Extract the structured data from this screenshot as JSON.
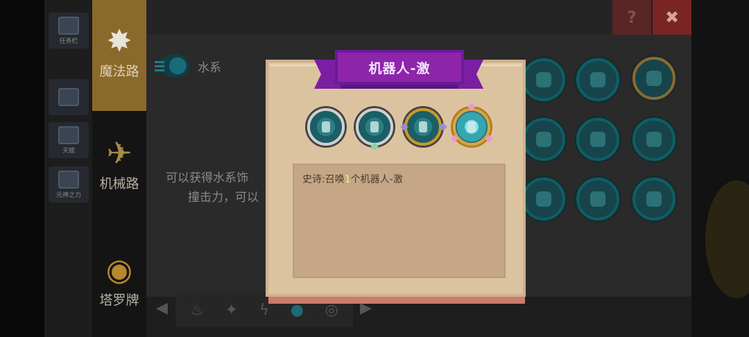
{
  "app": {
    "categories": [
      {
        "label": "魔法路",
        "icon": "sparkle-icon",
        "active": true
      },
      {
        "label": "机械路",
        "icon": "wing-icon",
        "active": false
      },
      {
        "label": "塔罗牌",
        "icon": "eye-icon",
        "active": false
      }
    ],
    "element_label": "水系",
    "description_line1": "可以获得水系饰",
    "description_line2": "撞击力，可以",
    "help_label": "?",
    "close_label": "✖",
    "left_items": [
      "任务栏",
      "天赋",
      "元神之力"
    ]
  },
  "modal": {
    "title": "机器人-激",
    "variants": [
      {
        "name": "variant-1",
        "tier": "common"
      },
      {
        "name": "variant-2",
        "tier": "rare"
      },
      {
        "name": "variant-3",
        "tier": "epic"
      },
      {
        "name": "variant-4",
        "tier": "legendary"
      }
    ],
    "info_prefix": "史诗:召唤",
    "info_number": "1",
    "info_suffix": "个机器人-激"
  },
  "colors": {
    "ribbon": "#8e24aa",
    "parchment": "#dcc3a0",
    "highlight_number": "#e6ff5c",
    "category_active": "#8a6a2a"
  }
}
